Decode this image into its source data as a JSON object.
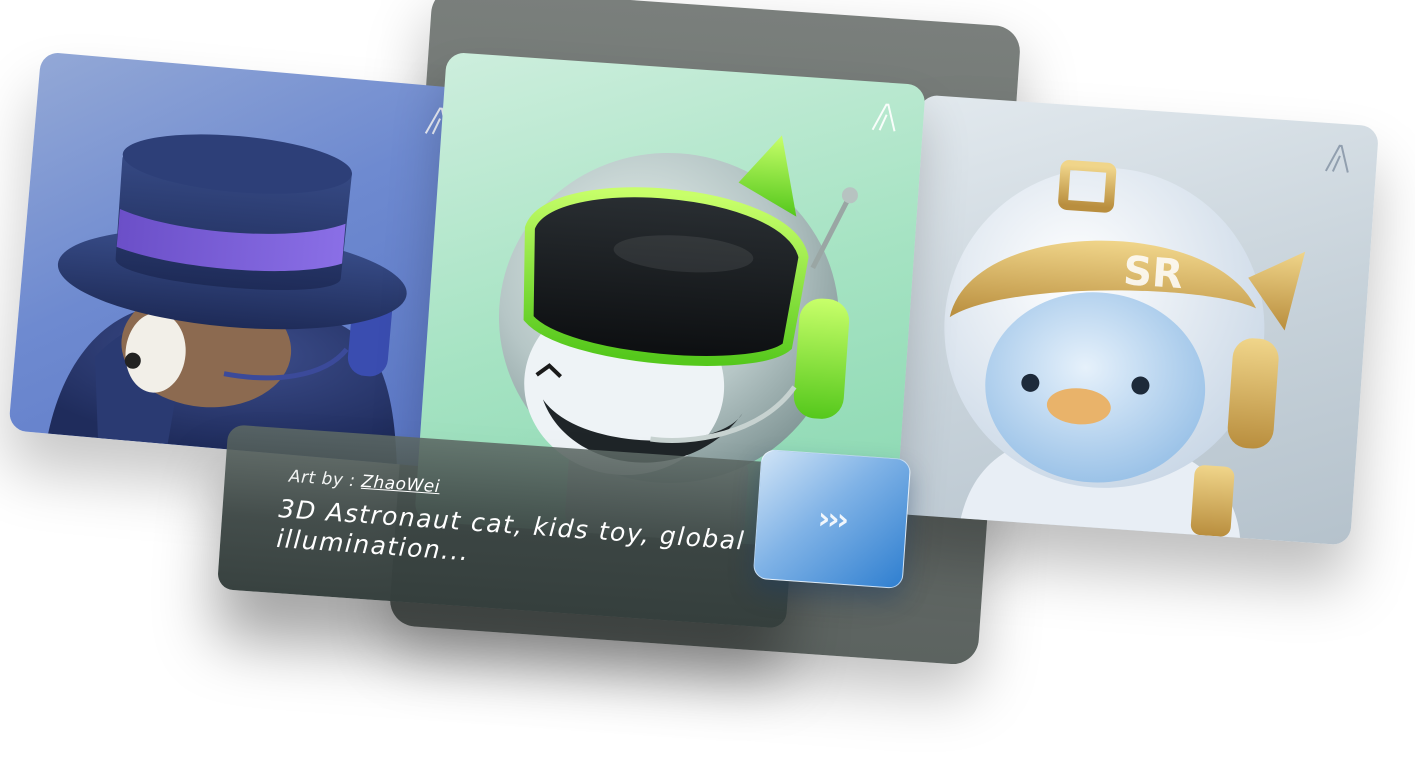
{
  "caption": {
    "credit_prefix": "Art by : ",
    "author": "ZhaoWei",
    "prompt": "3D Astronaut cat, kids toy, global illumination..."
  },
  "next_button": {
    "glyph": "›››"
  },
  "cards": [
    {
      "id": "left",
      "subject": "hat-character-art",
      "bg": "#6e8ad0"
    },
    {
      "id": "center",
      "subject": "astronaut-cat-art",
      "bg": "#a6e3c3"
    },
    {
      "id": "right",
      "subject": "astronaut-penguin-art",
      "bg": "#c7d2da"
    }
  ],
  "icons": {
    "brand": "brand-logo-icon",
    "next": "chevrons-right-icon"
  }
}
